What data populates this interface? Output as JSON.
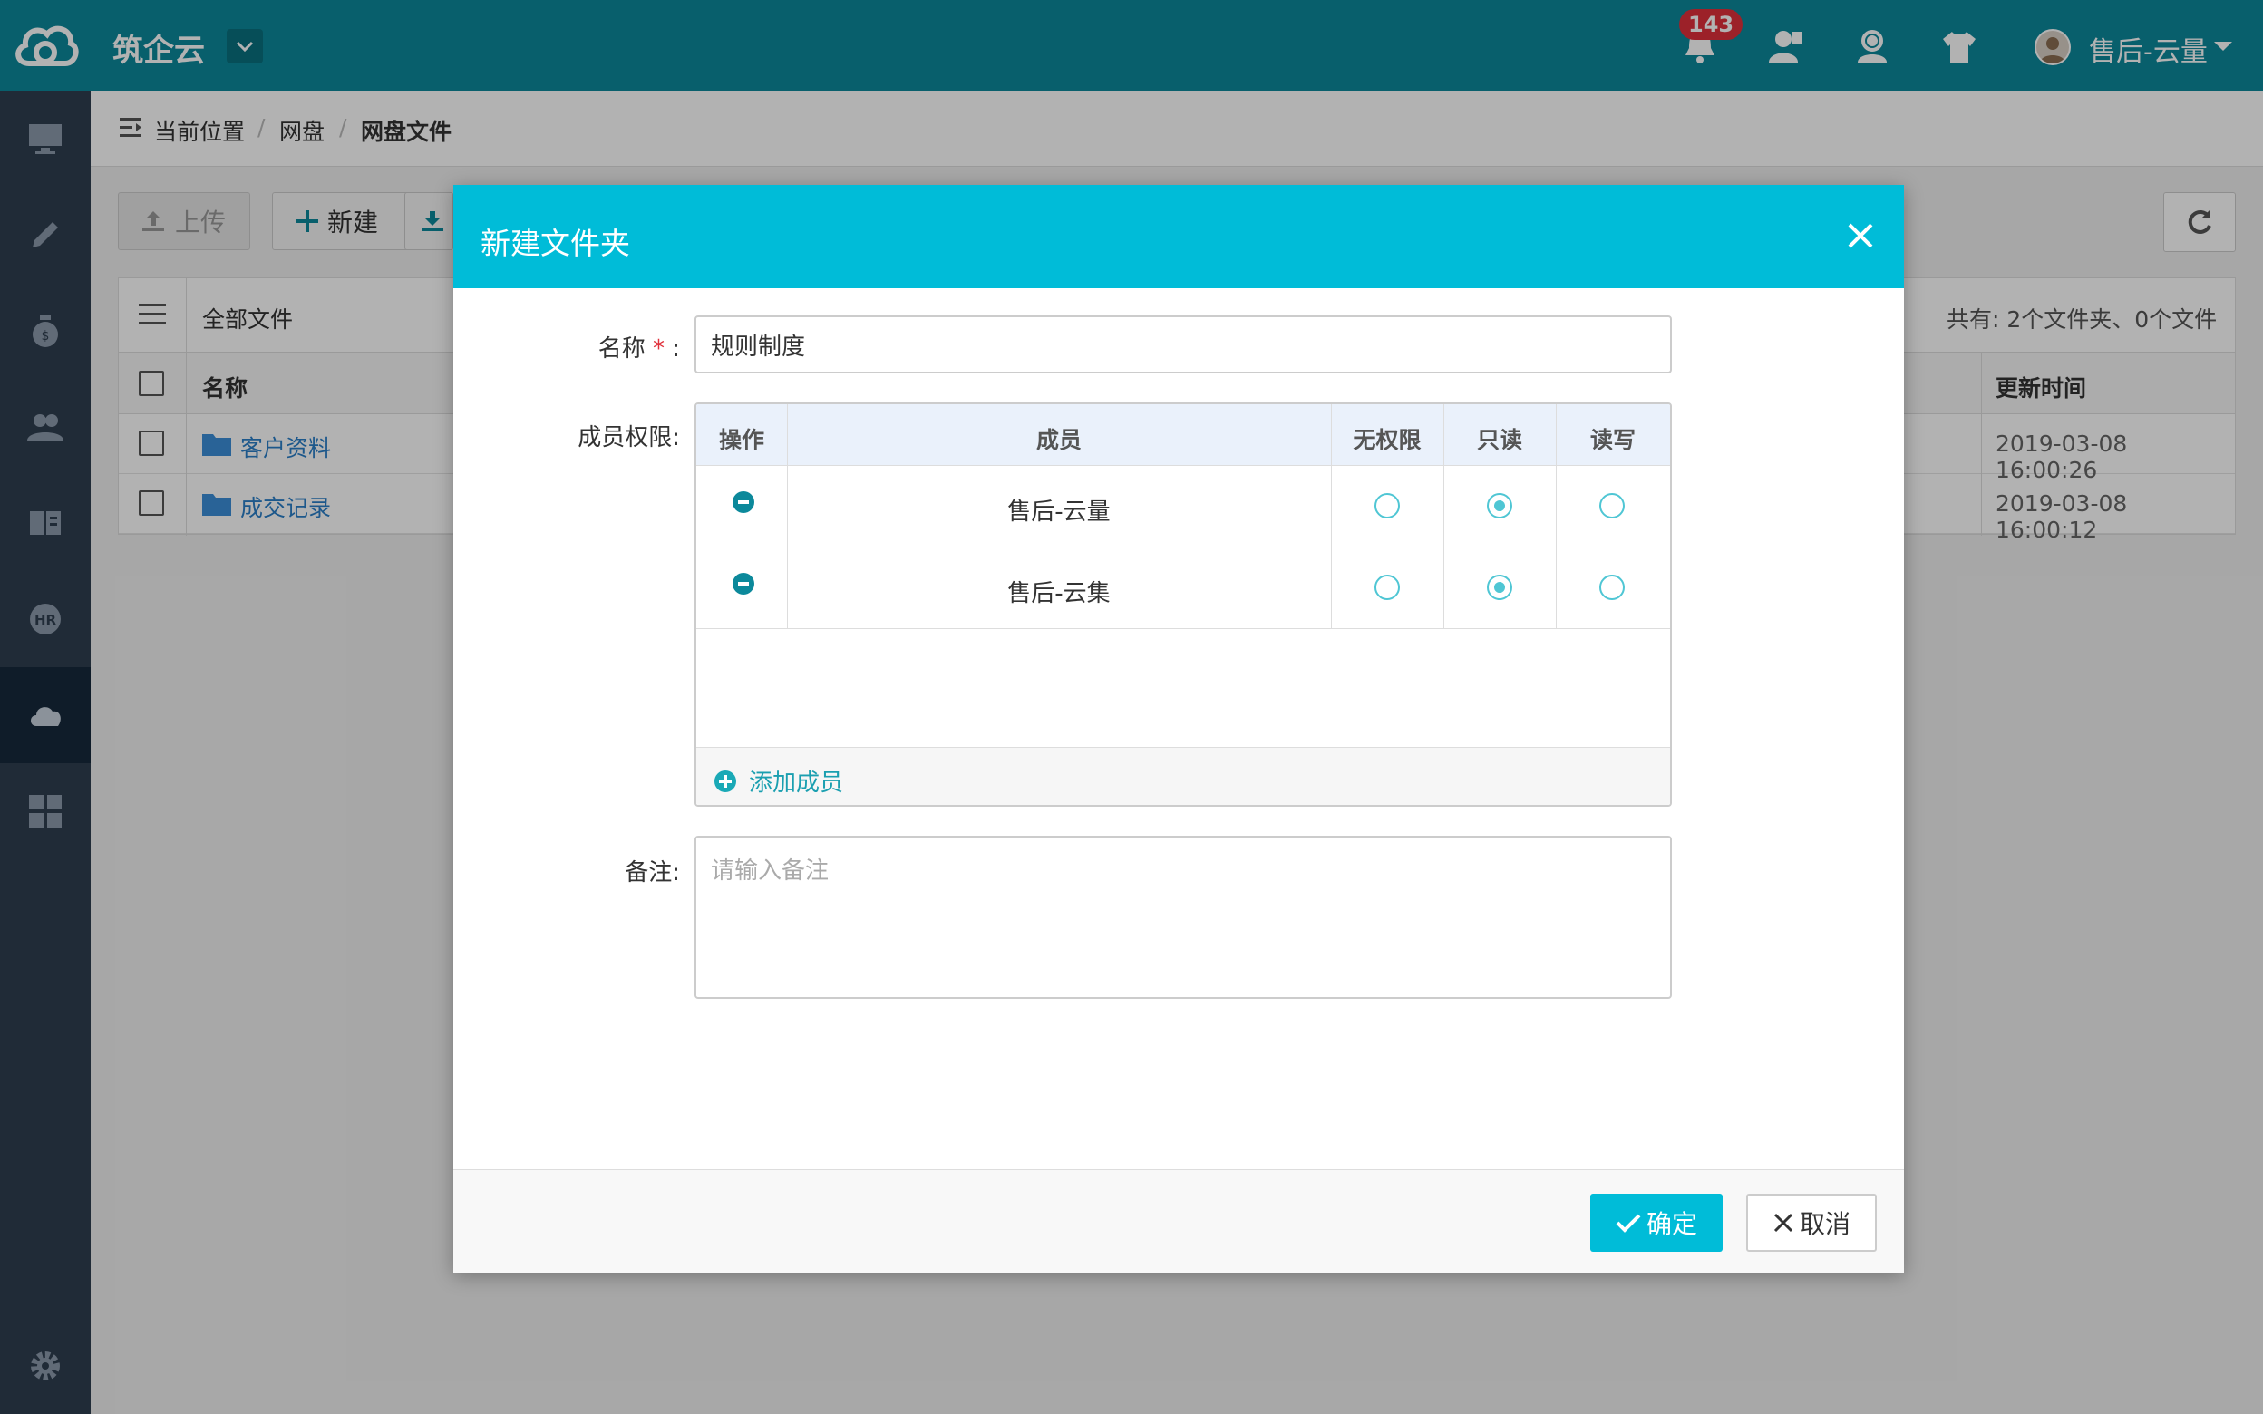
{
  "header": {
    "app_title": "筑企云",
    "notification_count": "143",
    "user_name": "售后-云量"
  },
  "sidebar": {
    "items": [
      {
        "icon": "monitor-icon"
      },
      {
        "icon": "pencil-icon"
      },
      {
        "icon": "money-bag-icon"
      },
      {
        "icon": "users-icon"
      },
      {
        "icon": "book-icon"
      },
      {
        "icon": "hr-icon"
      },
      {
        "icon": "cloud-icon",
        "active": true
      },
      {
        "icon": "grid-icon"
      }
    ],
    "settings_icon": "gear-icon"
  },
  "breadcrumb": {
    "label": "当前位置",
    "items": [
      "网盘",
      "网盘文件"
    ]
  },
  "toolbar": {
    "upload_label": "上传",
    "new_label": "新建"
  },
  "file_table": {
    "header_title": "全部文件",
    "summary": "共有: 2个文件夹、0个文件",
    "columns": {
      "name": "名称",
      "updated": "更新时间"
    },
    "rows": [
      {
        "name": "客户资料",
        "updated": "2019-03-08 16:00:26"
      },
      {
        "name": "成交记录",
        "updated": "2019-03-08 16:00:12"
      }
    ]
  },
  "modal": {
    "title": "新建文件夹",
    "name_label": "名称",
    "name_value": "规则制度",
    "members_label": "成员权限:",
    "perm_columns": {
      "action": "操作",
      "member": "成员",
      "none": "无权限",
      "read": "只读",
      "rw": "读写"
    },
    "members": [
      {
        "name": "售后-云量",
        "permission": "read"
      },
      {
        "name": "售后-云集",
        "permission": "read"
      }
    ],
    "add_member_label": "添加成员",
    "remark_label": "备注:",
    "remark_placeholder": "请输入备注",
    "ok_label": "确定",
    "cancel_label": "取消"
  },
  "colors": {
    "topbar": "#0c899b",
    "sidebar": "#2f3e4f",
    "modal_header": "#00bcd8",
    "accent": "#4fc6d4",
    "badge": "#e0303b"
  }
}
